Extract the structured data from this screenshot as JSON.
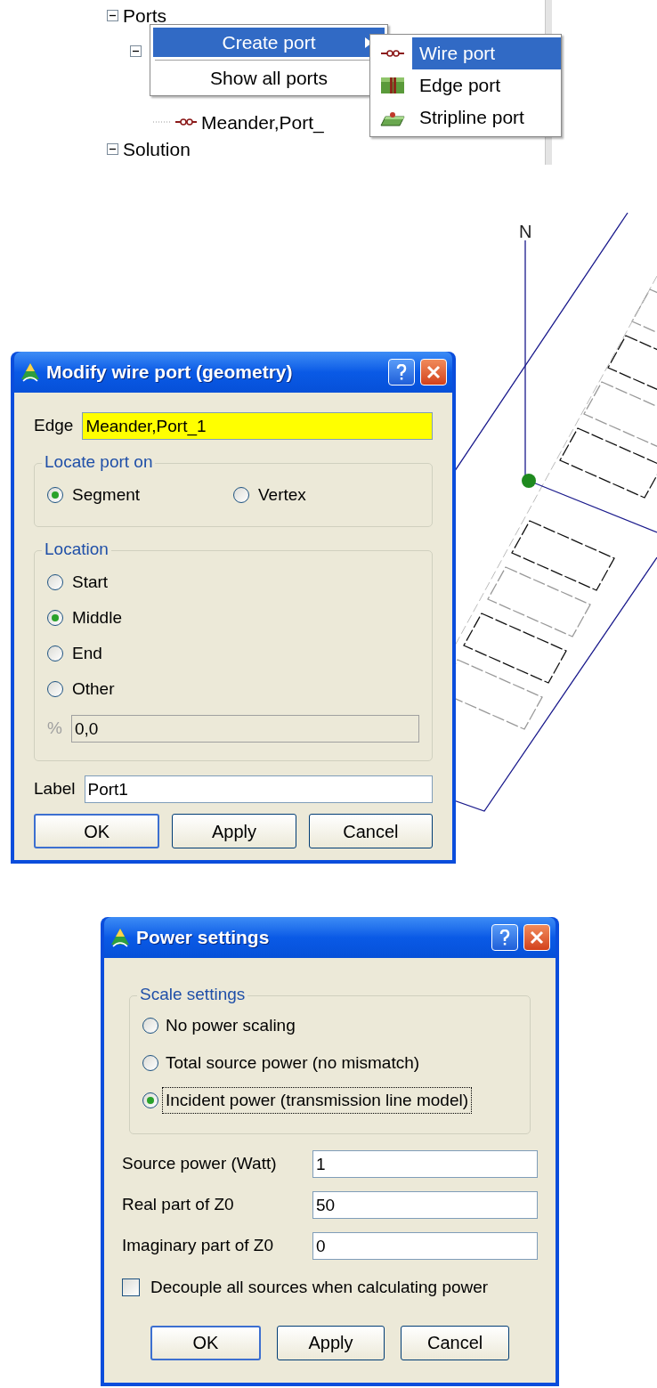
{
  "tree": {
    "items": [
      {
        "label": "Ports",
        "expanded": true,
        "children": [
          {
            "expanded": true,
            "children": [
              {
                "label": "Meander,Port_",
                "kind": "port"
              }
            ]
          }
        ]
      },
      {
        "label": "Solution",
        "expanded": true
      }
    ]
  },
  "context_menu": {
    "items": [
      {
        "label": "Create port",
        "submenu": true,
        "selected": true
      },
      {
        "label": "Show all ports",
        "submenu": false,
        "selected": false
      }
    ]
  },
  "submenu": {
    "items": [
      {
        "label": "Wire port",
        "kind": "wire",
        "selected": true
      },
      {
        "label": "Edge port",
        "kind": "edge",
        "selected": false
      },
      {
        "label": "Stripline port",
        "kind": "stripline",
        "selected": false
      }
    ]
  },
  "view": {
    "axis_label": "N"
  },
  "modify_dialog": {
    "title": "Modify wire port (geometry)",
    "edge": {
      "label": "Edge",
      "value": "Meander,Port_1",
      "highlighted": true
    },
    "locate_group": {
      "title": "Locate port on",
      "options": [
        {
          "label": "Segment",
          "selected": true
        },
        {
          "label": "Vertex",
          "selected": false
        }
      ]
    },
    "location_group": {
      "title": "Location",
      "options": [
        {
          "label": "Start",
          "selected": false
        },
        {
          "label": "Middle",
          "selected": true
        },
        {
          "label": "End",
          "selected": false
        },
        {
          "label": "Other",
          "selected": false
        }
      ],
      "percent": {
        "label": "%",
        "value": "0,0",
        "disabled": true
      }
    },
    "label_field": {
      "label": "Label",
      "value": "Port1"
    },
    "buttons": [
      {
        "label": "OK",
        "default": true
      },
      {
        "label": "Apply",
        "default": false
      },
      {
        "label": "Cancel",
        "default": false
      }
    ]
  },
  "power_dialog": {
    "title": "Power settings",
    "scale_group": {
      "title": "Scale settings",
      "options": [
        {
          "label": "No power scaling",
          "selected": false,
          "focused": false
        },
        {
          "label": "Total source power (no mismatch)",
          "selected": false,
          "focused": false
        },
        {
          "label": "Incident power (transmission line model)",
          "selected": true,
          "focused": true
        }
      ]
    },
    "fields": [
      {
        "label": "Source power (Watt)",
        "value": "1"
      },
      {
        "label": "Real part of Z0",
        "value": "50"
      },
      {
        "label": "Imaginary part of Z0",
        "value": "0"
      }
    ],
    "decouple": {
      "label": "Decouple all sources when calculating power",
      "checked": false
    },
    "buttons": [
      {
        "label": "OK",
        "default": true
      },
      {
        "label": "Apply",
        "default": false
      },
      {
        "label": "Cancel",
        "default": false
      }
    ]
  }
}
